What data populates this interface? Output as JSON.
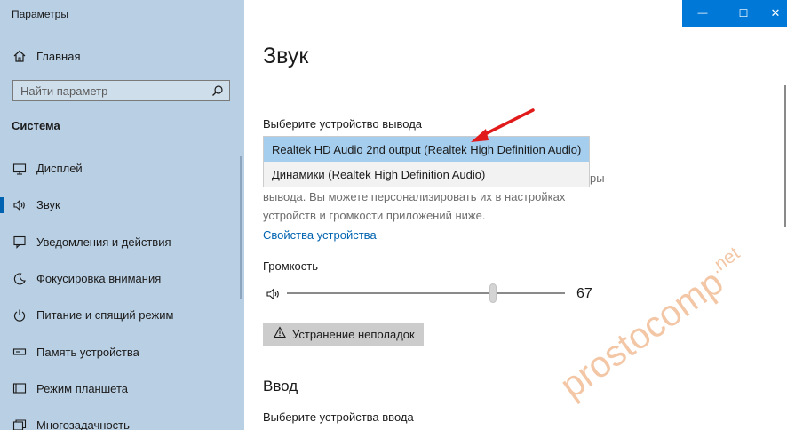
{
  "app": {
    "title": "Параметры"
  },
  "window_controls": {
    "minimize": "—",
    "maximize": "☐",
    "close": "✕",
    "accent": "#0078d7"
  },
  "sidebar": {
    "home_label": "Главная",
    "search_placeholder": "Найти параметр",
    "section_title": "Система",
    "items": [
      {
        "label": "Дисплей",
        "icon": "monitor-icon"
      },
      {
        "label": "Звук",
        "icon": "speaker-icon",
        "active": true
      },
      {
        "label": "Уведомления и действия",
        "icon": "notification-icon"
      },
      {
        "label": "Фокусировка внимания",
        "icon": "moon-icon"
      },
      {
        "label": "Питание и спящий режим",
        "icon": "power-icon"
      },
      {
        "label": "Память устройства",
        "icon": "storage-icon"
      },
      {
        "label": "Режим планшета",
        "icon": "tablet-icon"
      },
      {
        "label": "Многозадачность",
        "icon": "multitask-icon"
      }
    ]
  },
  "main": {
    "title": "Звук",
    "output_label": "Выберите устройство вывода",
    "output_options": [
      "Realtek HD Audio 2nd output (Realtek High Definition Audio)",
      "Динамики (Realtek High Definition Audio)"
    ],
    "description_partial_right": "ры",
    "description_line2": "вывода. Вы можете персонализировать их в настройках",
    "description_line3": "устройств и громкости приложений ниже.",
    "device_properties_link": "Свойства устройства",
    "volume_label": "Громкость",
    "volume_value": "67",
    "volume_level": 0.74,
    "troubleshoot_button": "Устранение неполадок",
    "input_section_title": "Ввод",
    "input_label": "Выберите устройства ввода"
  },
  "watermark": {
    "text": "prostocomp",
    "suffix": ".net"
  }
}
